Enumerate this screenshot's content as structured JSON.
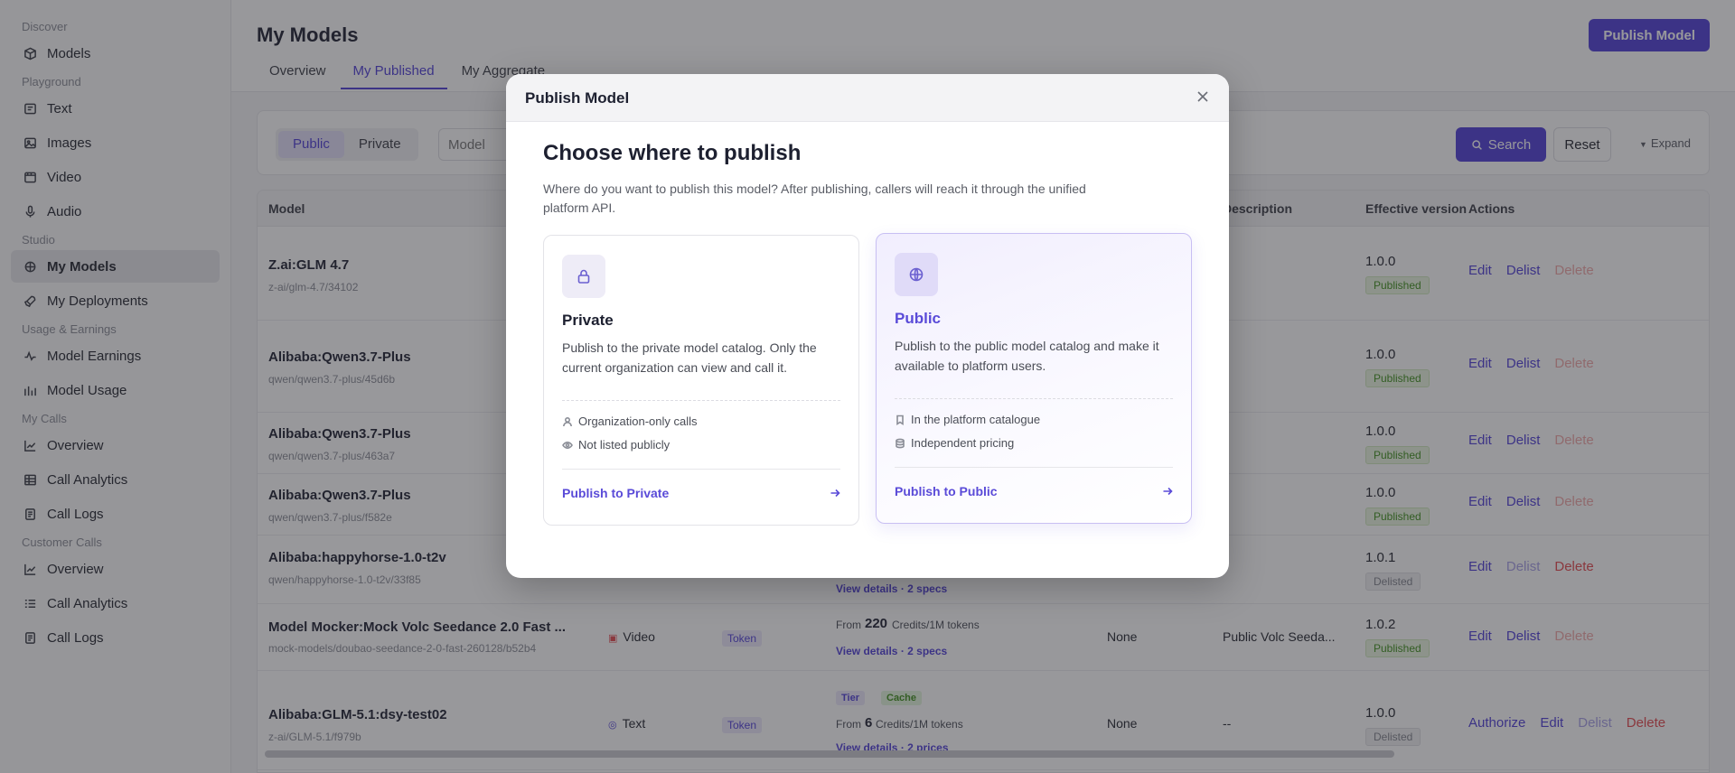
{
  "sidebar": {
    "groups": [
      {
        "title": "Discover",
        "items": [
          {
            "label": "Models",
            "icon": "cube-icon"
          }
        ]
      },
      {
        "title": "Playground",
        "items": [
          {
            "label": "Text",
            "icon": "text-icon"
          },
          {
            "label": "Images",
            "icon": "image-icon"
          },
          {
            "label": "Video",
            "icon": "video-icon"
          },
          {
            "label": "Audio",
            "icon": "mic-icon"
          }
        ]
      },
      {
        "title": "Studio",
        "items": [
          {
            "label": "My Models",
            "icon": "models-icon",
            "active": true
          },
          {
            "label": "My Deployments",
            "icon": "rocket-icon"
          }
        ]
      },
      {
        "title": "Usage & Earnings",
        "items": [
          {
            "label": "Model Earnings",
            "icon": "pulse-icon"
          },
          {
            "label": "Model Usage",
            "icon": "chart-icon"
          }
        ]
      },
      {
        "title": "My Calls",
        "items": [
          {
            "label": "Overview",
            "icon": "trend-icon"
          },
          {
            "label": "Call Analytics",
            "icon": "table-icon"
          },
          {
            "label": "Call Logs",
            "icon": "logs-icon"
          }
        ]
      },
      {
        "title": "Customer Calls",
        "items": [
          {
            "label": "Overview",
            "icon": "trend-icon"
          },
          {
            "label": "Call Analytics",
            "icon": "list-icon"
          },
          {
            "label": "Call Logs",
            "icon": "logs-icon"
          }
        ]
      }
    ]
  },
  "header": {
    "title": "My Models",
    "publish_label": "Publish Model",
    "tabs": [
      "Overview",
      "My Published",
      "My Aggregate"
    ],
    "active_tab": "My Published"
  },
  "filters": {
    "segments": [
      "Public",
      "Private"
    ],
    "model_placeholder": "Model",
    "search_label": "Search",
    "reset_label": "Reset",
    "expand_label": "Expand"
  },
  "table": {
    "columns": {
      "model": "Model",
      "description": "Description",
      "effective_version": "Effective version",
      "actions": "Actions"
    },
    "rows": [
      {
        "name": "Z.ai:GLM 4.7",
        "path": "z-ai/glm-4.7/34102",
        "version": "1.0.0",
        "status": "Published"
      },
      {
        "name": "Alibaba:Qwen3.7-Plus",
        "path": "qwen/qwen3.7-plus/45d6b",
        "version": "1.0.0",
        "status": "Published"
      },
      {
        "name": "Alibaba:Qwen3.7-Plus",
        "path": "qwen/qwen3.7-plus/463a7",
        "version": "1.0.0",
        "status": "Published"
      },
      {
        "name": "Alibaba:Qwen3.7-Plus",
        "path": "qwen/qwen3.7-plus/f582e",
        "version": "1.0.0",
        "status": "Published"
      },
      {
        "name": "Alibaba:happyhorse-1.0-t2v",
        "path": "qwen/happyhorse-1.0-t2v/33f85",
        "version": "1.0.1",
        "status": "Delisted",
        "details": "View details · 2 specs"
      },
      {
        "name": "Model Mocker:Mock Volc Seedance 2.0 Fast ...",
        "path": "mock-models/doubao-seedance-2-0-fast-260128/b52b4",
        "type": "Video",
        "billing": "Token",
        "price_from": "From",
        "price": "220",
        "price_unit": "Credits/1M tokens",
        "details": "View details · 2 specs",
        "none": "None",
        "description": "Public Volc Seeda...",
        "version": "1.0.2",
        "status": "Published"
      },
      {
        "name": "Alibaba:GLM-5.1:dsy-test02",
        "path": "z-ai/GLM-5.1/f979b",
        "type": "Text",
        "billing": "Token",
        "tier": "Tier",
        "cache": "Cache",
        "price_from": "From",
        "price": "6",
        "price_unit": "Credits/1M tokens",
        "details": "View details · 2 prices",
        "none": "None",
        "description": "--",
        "version": "1.0.0",
        "status": "Delisted"
      }
    ],
    "actions": {
      "authorize": "Authorize",
      "edit": "Edit",
      "delist": "Delist",
      "delete": "Delete"
    }
  },
  "modal": {
    "title": "Publish Model",
    "heading": "Choose where to publish",
    "description": "Where do you want to publish this model? After publishing, callers will reach it through the unified platform API.",
    "private": {
      "title": "Private",
      "description": "Publish to the private model catalog. Only the current organization can view and call it.",
      "features": [
        "Organization-only calls",
        "Not listed publicly"
      ],
      "cta": "Publish to Private",
      "icon": "lock-icon"
    },
    "public": {
      "title": "Public",
      "description": "Publish to the public model catalog and make it available to platform users.",
      "features": [
        "In the platform catalogue",
        "Independent pricing"
      ],
      "cta": "Publish to Public",
      "icon": "globe-icon"
    }
  },
  "colors": {
    "accent": "#4f3fd6",
    "published": "#3e8f1c",
    "danger": "#e5484d"
  }
}
